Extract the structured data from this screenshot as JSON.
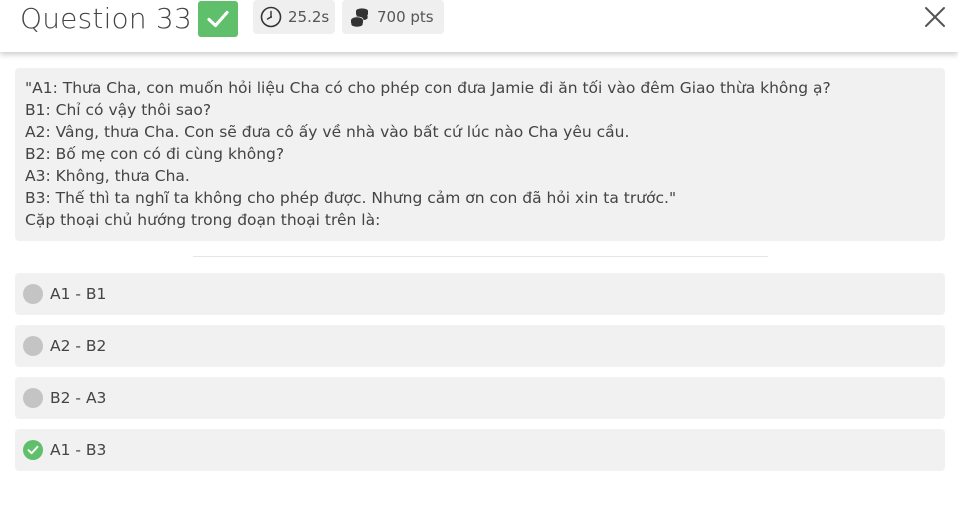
{
  "header": {
    "title": "Question 33",
    "timer": "25.2s",
    "points": "700 pts",
    "accent_color": "#5fbf6a"
  },
  "question": {
    "lines": [
      "\"A1: Thưa Cha, con muốn hỏi liệu Cha có cho phép con đưa Jamie đi ăn tối vào đêm Giao thừa không ạ?",
      "B1: Chỉ có vậy thôi sao?",
      "A2: Vâng, thưa Cha. Con sẽ đưa cô ấy về nhà vào bất cứ lúc nào Cha yêu cầu.",
      "B2: Bố mẹ con có đi cùng không?",
      "A3: Không, thưa Cha.",
      "B3: Thế thì ta nghĩ ta không cho phép được. Nhưng cảm ơn con đã hỏi xin ta trước.\"",
      "Cặp thoại chủ hướng trong đoạn thoại trên là:"
    ]
  },
  "options": [
    {
      "label": "A1 - B1",
      "state": "unselected"
    },
    {
      "label": "A2 - B2",
      "state": "unselected"
    },
    {
      "label": "B2 - A3",
      "state": "unselected"
    },
    {
      "label": "A1 - B3",
      "state": "correct"
    }
  ],
  "icons": {
    "check": "check-icon",
    "timer": "clock-icon",
    "points": "coins-icon",
    "close": "close-icon"
  }
}
